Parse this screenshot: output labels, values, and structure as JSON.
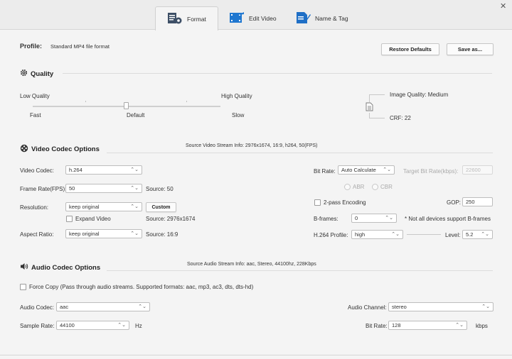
{
  "tabs": [
    {
      "label": "Format",
      "icon": "format-icon"
    },
    {
      "label": "Edit Video",
      "icon": "edit-video-icon"
    },
    {
      "label": "Name & Tag",
      "icon": "name-tag-icon"
    }
  ],
  "profile": {
    "label": "Profile:",
    "value": "Standard MP4 file format"
  },
  "buttons": {
    "restore": "Restore Defaults",
    "save_as": "Save as...",
    "custom": "Custom"
  },
  "quality": {
    "title": "Quality",
    "low": "Low Quality",
    "high": "High Quality",
    "fast": "Fast",
    "default": "Default",
    "slow": "Slow",
    "image_quality": "Image Quality: Medium",
    "crf": "CRF: 22",
    "slider_position": 0.5
  },
  "video": {
    "title": "Video Codec Options",
    "stream_info": "Source Video Stream Info: 2976x1674, 16:9, h264, 50(FPS)",
    "codec_label": "Video Codec:",
    "codec_value": "h.264",
    "fps_label": "Frame Rate(FPS):",
    "fps_value": "50",
    "fps_source": "Source: 50",
    "res_label": "Resolution:",
    "res_value": "keep original",
    "expand_label": "Expand Video",
    "res_source": "Source: 2976x1674",
    "aspect_label": "Aspect Ratio:",
    "aspect_value": "keep original",
    "aspect_source": "Source: 16:9",
    "bitrate_label": "Bit Rate:",
    "bitrate_value": "Auto Calculate",
    "target_label": "Target Bit Rate(kbps):",
    "target_value": "22600",
    "abr": "ABR",
    "cbr": "CBR",
    "twopass_label": "2-pass Encoding",
    "gop_label": "GOP:",
    "gop_value": "250",
    "bframes_label": "B-frames:",
    "bframes_value": "0",
    "bframes_note": "* Not all devices support B-frames",
    "profile_label": "H.264 Profile:",
    "profile_value": "high",
    "level_label": "Level:",
    "level_value": "5.2"
  },
  "audio": {
    "title": "Audio Codec Options",
    "stream_info": "Source Audio Stream Info: aac, Stereo, 44100hz, 228Kbps",
    "force_copy": "Force Copy (Pass through audio streams. Supported formats: aac, mp3, ac3, dts, dts-hd)",
    "codec_label": "Audio Codec:",
    "codec_value": "aac",
    "channel_label": "Audio Channel:",
    "channel_value": "stereo",
    "sample_label": "Sample Rate:",
    "sample_value": "44100",
    "sample_unit": "Hz",
    "bitrate_label": "Bit Rate:",
    "bitrate_value": "128",
    "bitrate_unit": "kbps"
  }
}
